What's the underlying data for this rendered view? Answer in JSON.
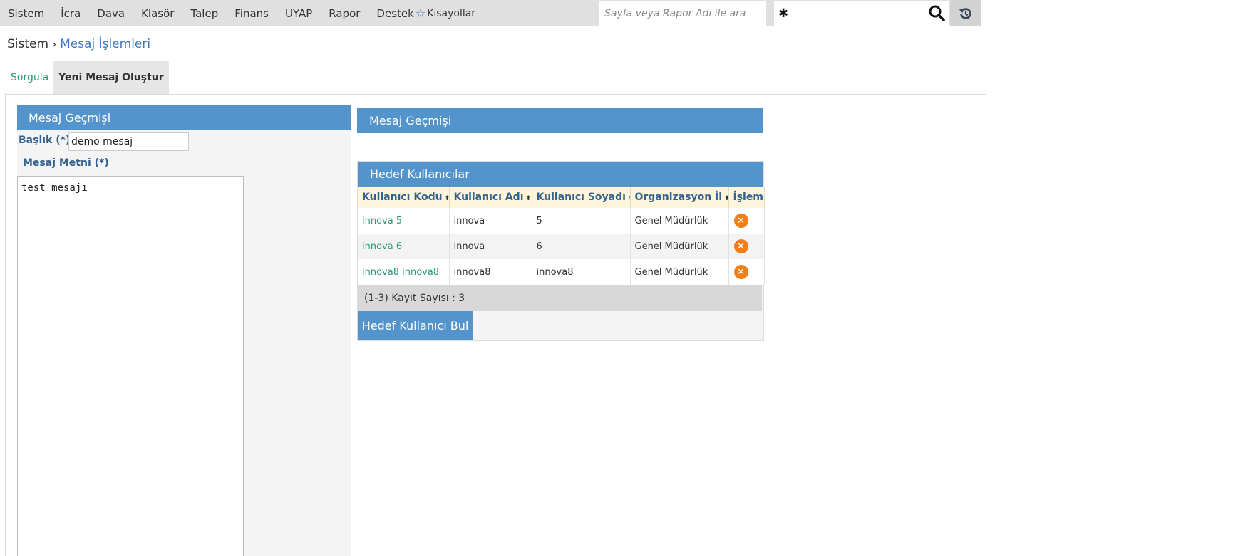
{
  "menu": {
    "items": [
      "Sistem",
      "İcra",
      "Dava",
      "Klasör",
      "Talep",
      "Finans",
      "UYAP",
      "Rapor",
      "Destek"
    ],
    "shortcuts_label": "Kısayollar"
  },
  "search": {
    "page_placeholder": "Sayfa veya Rapor Adı ile ara",
    "query_value": ""
  },
  "breadcrumb": {
    "root": "Sistem",
    "current": "Mesaj İşlemleri"
  },
  "tabs": {
    "query": "Sorgula",
    "new_message": "Yeni Mesaj Oluştur"
  },
  "left_panel": {
    "header": "Mesaj Geçmişi",
    "title_label": "Başlık (*)",
    "title_value": "demo mesaj",
    "body_label": "Mesaj Metni (*)",
    "body_value": "test mesajı"
  },
  "right_top": {
    "header": "Mesaj Geçmişi"
  },
  "target_users": {
    "header": "Hedef Kullanıcılar",
    "columns": [
      "Kullanıcı Kodu",
      "Kullanıcı Adı",
      "Kullanıcı Soyadı",
      "Organizasyon İl",
      "İşlem"
    ],
    "rows": [
      {
        "code": "innova 5",
        "name": "innova",
        "surname": "5",
        "org": "Genel Müdürlük"
      },
      {
        "code": "innova 6",
        "name": "innova",
        "surname": "6",
        "org": "Genel Müdürlük"
      },
      {
        "code": "innova8 innova8",
        "name": "innova8",
        "surname": "innova8",
        "org": "Genel Müdürlük"
      }
    ],
    "record_count": "(1-3) Kayıt Sayısı : 3",
    "find_button": "Hedef Kullanıcı Bul"
  },
  "colors": {
    "accent": "#5294cb",
    "link": "#2d9a7a",
    "delete": "#f07f1a",
    "label": "#34628f"
  },
  "icons": {
    "shortcuts": "star-icon",
    "settings": "gear-icon",
    "search": "search-icon",
    "history": "history-icon",
    "row_delete": "remove-icon"
  }
}
